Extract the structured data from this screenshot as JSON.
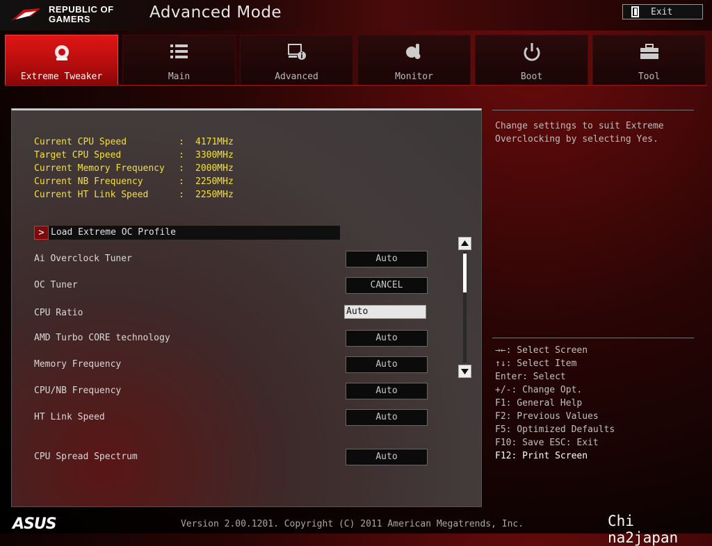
{
  "header": {
    "brand_line1": "REPUBLIC OF",
    "brand_line2": "GAMERS",
    "title": "Advanced Mode",
    "exit_label": "Exit"
  },
  "tabs": [
    {
      "label": "Extreme Tweaker",
      "icon": "tweaker-icon",
      "active": true
    },
    {
      "label": "Main",
      "icon": "list-icon",
      "active": false
    },
    {
      "label": "Advanced",
      "icon": "advanced-info-icon",
      "active": false
    },
    {
      "label": "Monitor",
      "icon": "thermometer-icon",
      "active": false
    },
    {
      "label": "Boot",
      "icon": "power-icon",
      "active": false
    },
    {
      "label": "Tool",
      "icon": "toolbox-icon",
      "active": false
    }
  ],
  "info": [
    {
      "label": "Current CPU Speed",
      "value": "4171MHz"
    },
    {
      "label": "Target CPU Speed",
      "value": "3300MHz"
    },
    {
      "label": "Current Memory Frequency",
      "value": "2000MHz"
    },
    {
      "label": "Current NB Frequency",
      "value": "2250MHz"
    },
    {
      "label": "Current HT Link Speed",
      "value": "2250MHz"
    }
  ],
  "submenu": {
    "label": "Load Extreme OC Profile",
    "arrow": ">"
  },
  "settings": [
    {
      "label": "Ai Overclock Tuner",
      "value": "Auto"
    },
    {
      "label": "OC Tuner",
      "value": "CANCEL"
    },
    {
      "label": "CPU Ratio",
      "value": "Auto"
    },
    {
      "label": "AMD Turbo CORE technology",
      "value": "Auto"
    },
    {
      "label": "Memory Frequency",
      "value": "Auto"
    },
    {
      "label": "CPU/NB Frequency",
      "value": "Auto"
    },
    {
      "label": "HT Link Speed",
      "value": "Auto"
    },
    {
      "label": "CPU Spread Spectrum",
      "value": "Auto"
    }
  ],
  "help": {
    "description": "Change settings to suit Extreme Overclocking by selecting Yes."
  },
  "keys": [
    "→←: Select Screen",
    "↑↓: Select Item",
    "Enter: Select",
    "+/-: Change Opt.",
    "F1: General Help",
    "F2: Previous Values",
    "F5: Optimized Defaults",
    "F10: Save  ESC: Exit",
    "F12: Print Screen"
  ],
  "footer": {
    "logo": "ASUS",
    "version": "Version 2.00.1201. Copyright (C) 2011 American Megatrends, Inc.",
    "watermark": "Chi na2japan"
  },
  "colors": {
    "accent_red": "#d81414",
    "info_yellow": "#f2e03a"
  }
}
